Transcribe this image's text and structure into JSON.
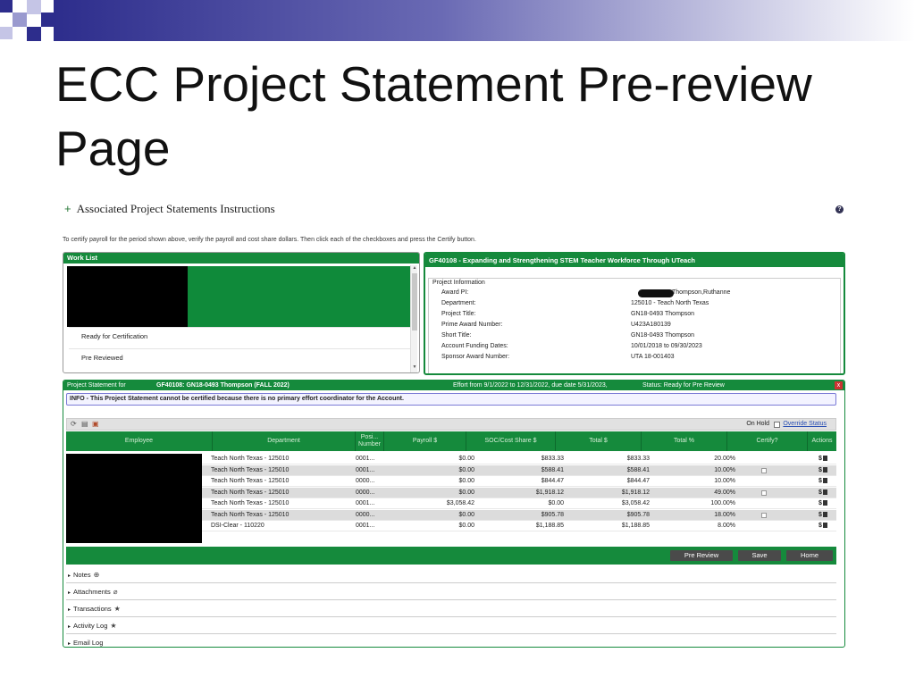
{
  "slide": {
    "title": "ECC Project Statement Pre-review Page"
  },
  "instructions": {
    "expander": "+",
    "heading": "Associated Project Statements Instructions",
    "help": "?",
    "text": "To certify payroll for the period shown above, verify the payroll and cost share dollars. Then click each of the checkboxes and press the Certify button."
  },
  "worklist": {
    "title": "Work List",
    "items": [
      "Ready for Certification",
      "Pre Reviewed"
    ]
  },
  "project_info": {
    "header": "GF40108 - Expanding and Strengthening STEM Teacher Workforce Through UTeach",
    "section_label": "Project Information",
    "rows": [
      {
        "label": "Award PI:",
        "value": "Thompson,Ruthanne"
      },
      {
        "label": "Department:",
        "value": "125010 - Teach North Texas"
      },
      {
        "label": "Project Title:",
        "value": "GN18-0493 Thompson"
      },
      {
        "label": "Prime Award Number:",
        "value": "U423A180139"
      },
      {
        "label": "Short Title:",
        "value": "GN18-0493 Thompson"
      },
      {
        "label": "Account Funding Dates:",
        "value": "10/01/2018 to 09/30/2023"
      },
      {
        "label": "Sponsor Award Number:",
        "value": "UTA 18-001403"
      }
    ]
  },
  "statement": {
    "label": "Project Statement for",
    "project": "GF40108: GN18-0493 Thompson (FALL 2022)",
    "period": "Effort from 9/1/2022 to 12/31/2022, due date 5/31/2023,",
    "status": "Status: Ready for Pre Review",
    "close": "x",
    "info": "INFO - This Project Statement cannot be certified because there is no primary effort coordinator for the Account.",
    "on_hold": "On Hold",
    "override": "Override Status",
    "columns": [
      "Employee",
      "Department",
      "Posi... Number",
      "Payroll $",
      "SOC/Cost Share $",
      "Total $",
      "Total %",
      "Certify?",
      "Actions"
    ],
    "rows": [
      {
        "department": "Teach North Texas - 125010",
        "position": "0001...",
        "payroll": "$0.00",
        "cost_share": "$833.33",
        "total": "$833.33",
        "pct": "20.00%",
        "certify": false,
        "actions": "$"
      },
      {
        "department": "Teach North Texas - 125010",
        "position": "0001...",
        "payroll": "$0.00",
        "cost_share": "$588.41",
        "total": "$588.41",
        "pct": "10.00%",
        "certify": true,
        "actions": "$"
      },
      {
        "department": "Teach North Texas - 125010",
        "position": "0000...",
        "payroll": "$0.00",
        "cost_share": "$844.47",
        "total": "$844.47",
        "pct": "10.00%",
        "certify": false,
        "actions": "$"
      },
      {
        "department": "Teach North Texas - 125010",
        "position": "0000...",
        "payroll": "$0.00",
        "cost_share": "$1,918.12",
        "total": "$1,918.12",
        "pct": "49.00%",
        "certify": true,
        "actions": "$"
      },
      {
        "department": "Teach North Texas - 125010",
        "position": "0001...",
        "payroll": "$3,058.42",
        "cost_share": "$0.00",
        "total": "$3,058.42",
        "pct": "100.00%",
        "certify": false,
        "actions": "$"
      },
      {
        "department": "Teach North Texas - 125010",
        "position": "0000...",
        "payroll": "$0.00",
        "cost_share": "$905.78",
        "total": "$905.78",
        "pct": "18.00%",
        "certify": true,
        "actions": "$"
      },
      {
        "department": "DSI-Clear - 110220",
        "position": "0001...",
        "payroll": "$0.00",
        "cost_share": "$1,188.85",
        "total": "$1,188.85",
        "pct": "8.00%",
        "certify": false,
        "actions": "$"
      }
    ],
    "buttons": {
      "pre_review": "Pre Review",
      "save": "Save",
      "home": "Home"
    }
  },
  "accordions": [
    {
      "label": "Notes",
      "icon": "plus-circle-icon",
      "glyph": "⊕"
    },
    {
      "label": "Attachments",
      "icon": "paperclip-icon",
      "glyph": "⌀"
    },
    {
      "label": "Transactions",
      "icon": "star-icon",
      "glyph": "★"
    },
    {
      "label": "Activity Log",
      "icon": "star-icon",
      "glyph": "★"
    },
    {
      "label": "Email Log",
      "icon": "",
      "glyph": ""
    }
  ],
  "colors": {
    "brand_green": "#158a3c",
    "title_bar_dark": "#2d2d8c"
  }
}
